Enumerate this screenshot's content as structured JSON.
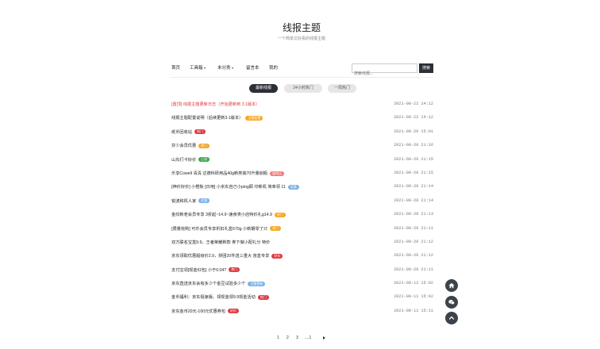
{
  "site": {
    "title": "线报主题",
    "subtitle": "一个简单又好看的线报主题"
  },
  "nav": {
    "items": [
      {
        "label": "首页",
        "dropdown": false
      },
      {
        "label": "工具箱",
        "dropdown": true
      },
      {
        "label": "未分类",
        "dropdown": true
      },
      {
        "label": "留言本",
        "dropdown": false
      },
      {
        "label": "我的",
        "dropdown": false
      }
    ],
    "search_placeholder": "搜索线报...",
    "search_label": "搜索"
  },
  "tabs": [
    {
      "label": "最新线报",
      "active": true
    },
    {
      "label": "24小时热门",
      "active": false
    },
    {
      "label": "一周热门",
      "active": false
    }
  ],
  "posts": [
    {
      "title": "[置顶] 线报主题更新日志（开始更新到 3.1版本）",
      "date": "2021-08-22 14:12",
      "red": true
    },
    {
      "title": "线报主题配置说明（后续更新3.1版本）",
      "date": "2021-08-22 14:12",
      "badge": "主题配置",
      "badge_color": "#f5a623"
    },
    {
      "title": "纸币回收站",
      "date": "2021-08-20 15:01",
      "badge": "热门",
      "badge_color": "#e0393e"
    },
    {
      "title": "芬少会员优惠",
      "date": "2021-08-20 21:16",
      "badge": "热门",
      "badge_color": "#f5a623"
    },
    {
      "title": "山东打卡好价",
      "date": "2021-08-20 21:15",
      "badge": "已领",
      "badge_color": "#3aa84a"
    },
    {
      "title": "乐享Cowell 清清 达德科研用品40g新类装70升量削瓶",
      "date": "2021-08-20 21:15",
      "badge": "值得买",
      "badge_color": "#f07a7a"
    },
    {
      "title": "[神价好价] 小橙板 [日用] 小京东自己小ping顾 印新机  简单领 11",
      "date": "2021-08-20 21:14",
      "badge": "优惠",
      "badge_color": "#7ab3e8"
    },
    {
      "title": "锐波和机人家",
      "date": "2021-08-20 21:14",
      "badge": "优惠",
      "badge_color": "#7ab3e8"
    },
    {
      "title": "金纹新老会员专享 3折起~14.9~速食类小店特价礼g14.9",
      "date": "2021-08-20 21:13",
      "badge": "热门",
      "badge_color": "#f5a623"
    },
    {
      "title": "[限量抢购] 可乐会员专享折扣礼盒670g 小新期零了只",
      "date": "2021-08-20 21:11",
      "badge": "热门",
      "badge_color": "#f5a623"
    },
    {
      "title": "双方联名宝盒9.9，王者荣耀新款 券下做小配礼分 特价",
      "date": "2021-08-20 21:12",
      "badge": "",
      "badge_color": ""
    },
    {
      "title": "京东领取优惠超级价2.9，拼团20件送三重大 盲盒专享",
      "date": "2021-08-20 21:12",
      "badge": "好价",
      "badge_color": "#e0393e"
    },
    {
      "title": "支付宝领[现金红包] 小于0.04?",
      "date": "2021-08-20 21:11",
      "badge": "热门",
      "badge_color": "#e0393e"
    },
    {
      "title": "京东直送京东会有多少个金豆试验多少个",
      "date": "2021-08-12 15:02",
      "badge": "主题更新",
      "badge_color": "#7ab3e8"
    },
    {
      "title": "金币福利：京东极速版、领现金领9.9现金活动",
      "date": "2021-08-11 15:42",
      "badge": "热门",
      "badge_color": "#e0393e"
    },
    {
      "title": "京东金币20元-100元优惠券包",
      "date": "2021-08-11 15:11",
      "badge": "好价",
      "badge_color": "#e0393e"
    }
  ],
  "pagination": {
    "pages": [
      "1",
      "2",
      "3"
    ],
    "ellipsis": "....1"
  },
  "floating_buttons": [
    "home-icon",
    "chat-icon",
    "chevron-up-icon"
  ]
}
